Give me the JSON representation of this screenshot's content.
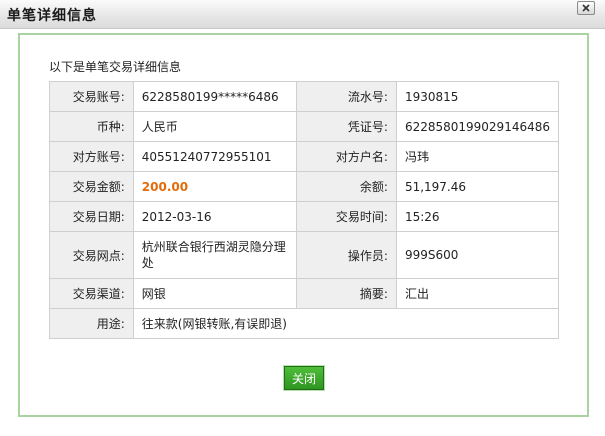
{
  "window": {
    "title": "单笔详细信息"
  },
  "intro": "以下是单笔交易详细信息",
  "rows": [
    {
      "l1": "交易账号:",
      "v1": "6228580199*****6486",
      "l2": "流水号:",
      "v2": "1930815"
    },
    {
      "l1": "币种:",
      "v1": "人民币",
      "l2": "凭证号:",
      "v2": "6228580199029146486"
    },
    {
      "l1": "对方账号:",
      "v1": "40551240772955101",
      "l2": "对方户名:",
      "v2": "冯玮"
    },
    {
      "l1": "交易金额:",
      "v1": "200.00",
      "l2": "余额:",
      "v2": "51,197.46"
    },
    {
      "l1": "交易日期:",
      "v1": "2012-03-16",
      "l2": "交易时间:",
      "v2": "15:26"
    },
    {
      "l1": "交易网点:",
      "v1": "杭州联合银行西湖灵隐分理处",
      "l2": "操作员:",
      "v2": "999S600"
    },
    {
      "l1": "交易渠道:",
      "v1": "网银",
      "l2": "摘要:",
      "v2": "汇出"
    }
  ],
  "purpose": {
    "label": "用途:",
    "value": "往来款(网银转账,有误即退)"
  },
  "buttons": {
    "close_label": "关闭"
  },
  "colors": {
    "amount": "#e36c0a",
    "button": "#2f9522",
    "panel_border": "#a9d4a1"
  }
}
